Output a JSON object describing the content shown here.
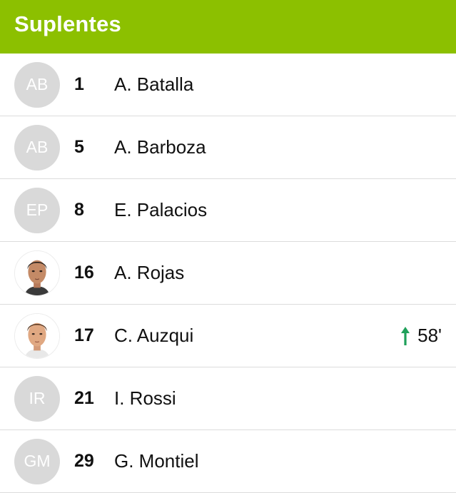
{
  "header": {
    "title": "Suplentes"
  },
  "colors": {
    "header_bg": "#8cc000",
    "avatar_placeholder": "#d9d9d9",
    "sub_in_arrow": "#1fa05a"
  },
  "players": [
    {
      "initials": "AB",
      "number": "1",
      "name": "A. Batalla",
      "avatar": "initials"
    },
    {
      "initials": "AB",
      "number": "5",
      "name": "A. Barboza",
      "avatar": "initials"
    },
    {
      "initials": "EP",
      "number": "8",
      "name": "E. Palacios",
      "avatar": "initials"
    },
    {
      "initials": "",
      "number": "16",
      "name": "A. Rojas",
      "avatar": "photo"
    },
    {
      "initials": "",
      "number": "17",
      "name": "C. Auzqui",
      "avatar": "photo",
      "sub_in_minute": "58'",
      "sub_icon": "arrow-up-icon"
    },
    {
      "initials": "IR",
      "number": "21",
      "name": "I. Rossi",
      "avatar": "initials"
    },
    {
      "initials": "GM",
      "number": "29",
      "name": "G. Montiel",
      "avatar": "initials"
    }
  ]
}
